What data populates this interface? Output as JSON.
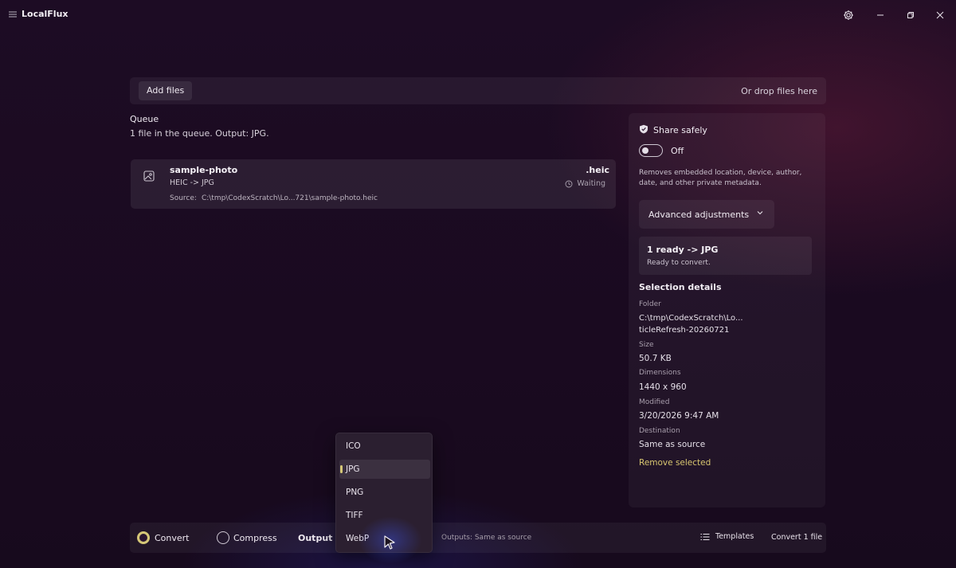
{
  "app": {
    "title": "LocalFlux"
  },
  "dropbar": {
    "add_files": "Add files",
    "hint": "Or drop files here"
  },
  "queue": {
    "title": "Queue",
    "summary": "1 file in the queue. Output: JPG.",
    "items": [
      {
        "name": "sample-photo",
        "conversion": "HEIC -> JPG",
        "source_label": "Source:",
        "source_path": "C:\\tmp\\CodexScratch\\Lo...721\\sample-photo.heic",
        "ext": ".heic",
        "status": "Waiting"
      }
    ]
  },
  "panel": {
    "share_title": "Share safely",
    "share_state": "Off",
    "share_desc": "Removes embedded location, device, author, date, and other private metadata.",
    "advanced": "Advanced adjustments",
    "ready_title": "1 ready -> JPG",
    "ready_sub": "Ready to convert.",
    "selection_title": "Selection details",
    "folder_label": "Folder",
    "folder_line1": "C:\\tmp\\CodexScratch\\Lo...",
    "folder_line2": "ticleRefresh-20260721",
    "size_label": "Size",
    "size_value": "50.7 KB",
    "dim_label": "Dimensions",
    "dim_value": "1440 x 960",
    "mod_label": "Modified",
    "mod_value": "3/20/2026 9:47 AM",
    "dest_label": "Destination",
    "dest_value": "Same as source",
    "remove": "Remove selected"
  },
  "bottom": {
    "convert": "Convert",
    "compress": "Compress",
    "output": "Output",
    "outputs_info": "Outputs: Same as source",
    "templates": "Templates",
    "convert_btn": "Convert 1 file"
  },
  "format_menu": {
    "options": [
      "ICO",
      "JPG",
      "PNG",
      "TIFF",
      "WebP"
    ],
    "selected": "JPG"
  },
  "colors": {
    "accent": "#d5c777",
    "background": "#1a0a20"
  }
}
